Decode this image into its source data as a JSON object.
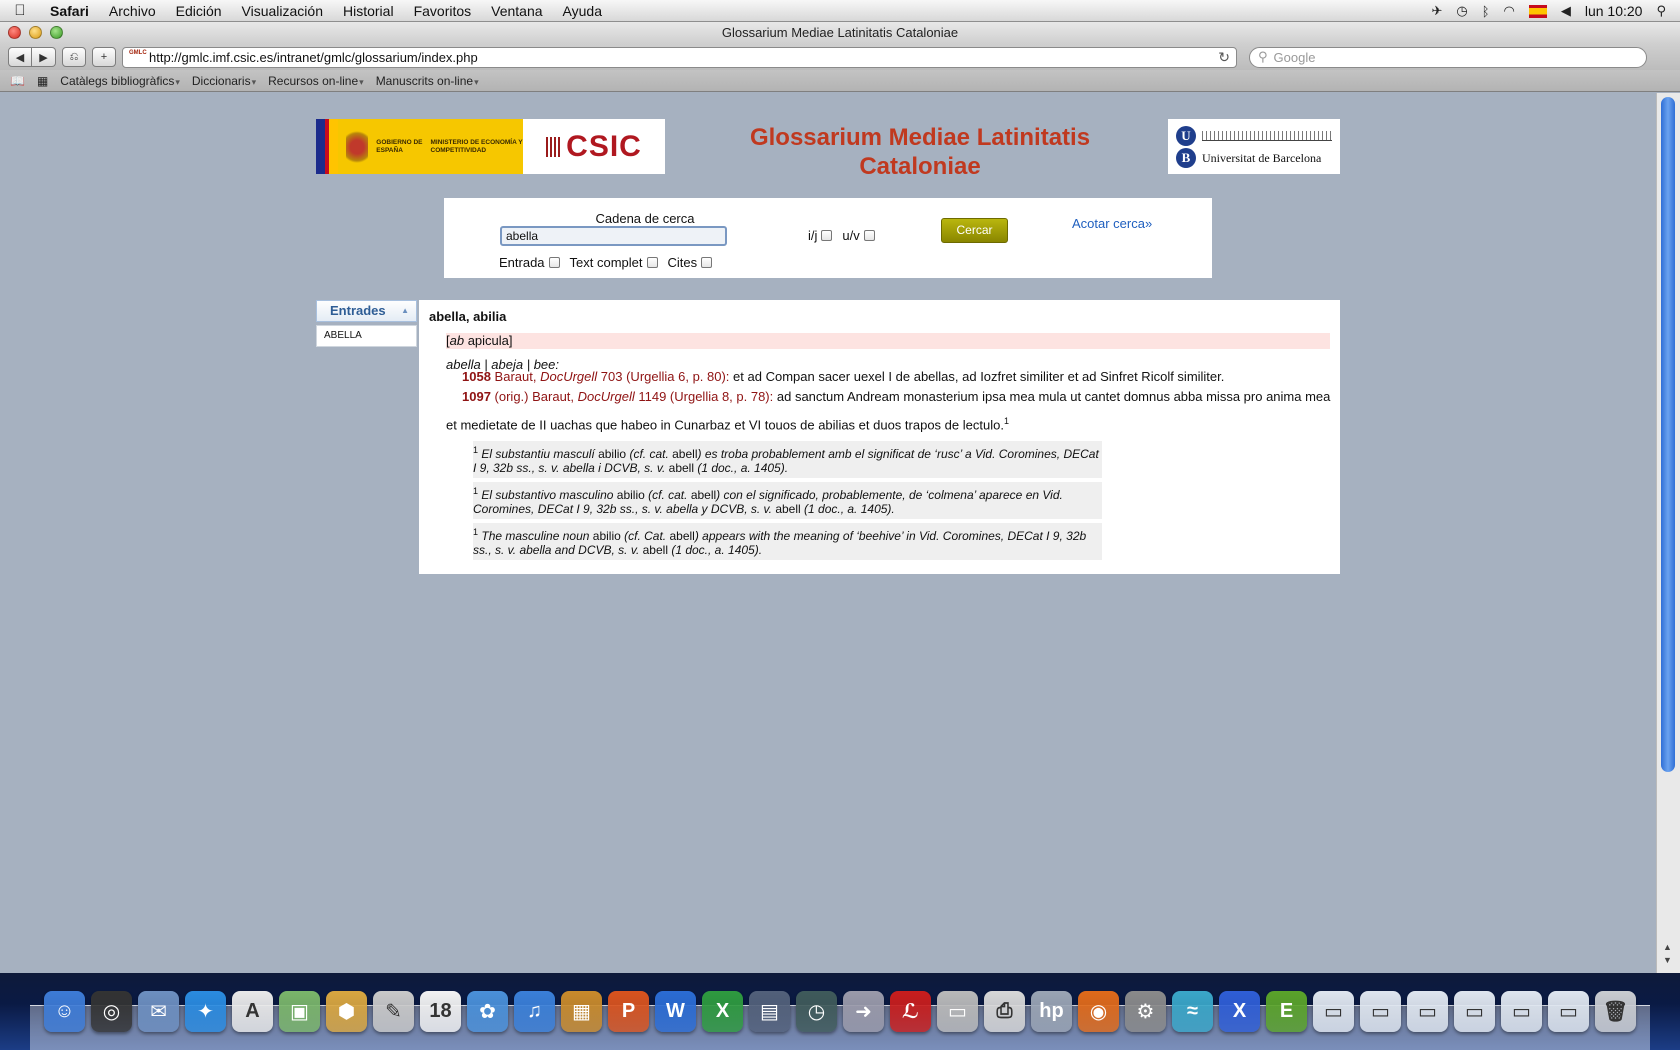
{
  "menubar": {
    "app": "Safari",
    "items": [
      "Archivo",
      "Edición",
      "Visualización",
      "Historial",
      "Favoritos",
      "Ventana",
      "Ayuda"
    ],
    "clock": "lun 10:20",
    "flag_label": "ISO"
  },
  "window": {
    "title": "Glossarium Mediae Latinitatis Cataloniae"
  },
  "toolbar": {
    "url": "http://gmlc.imf.csic.es/intranet/gmlc/glossarium/index.php",
    "search_placeholder": "Google",
    "favicon_text": "GMLC"
  },
  "bookmarks": {
    "items": [
      "Catàlegs bibliogràfics",
      "Diccionaris",
      "Recursos on-line",
      "Manuscrits on-line"
    ]
  },
  "header": {
    "gov_text": "GOBIERNO DE ESPAÑA",
    "ministry_text": "MINISTERIO DE ECONOMÍA Y COMPETITIVIDAD",
    "csic": "CSIC",
    "title": "Glossarium Mediae Latinitatis Cataloniae",
    "university": "Universitat de Barcelona"
  },
  "search": {
    "label": "Cadena de cerca",
    "value": "abella",
    "check_entrada": "Entrada",
    "check_text": "Text complet",
    "check_cites": "Cites",
    "check_ij": "i/j",
    "check_uv": "u/v",
    "button": "Cercar",
    "refine_link": "Acotar cerca»"
  },
  "entries": {
    "header": "Entrades",
    "items": [
      "ABELLA"
    ]
  },
  "article": {
    "headword": "abella, abilia",
    "etymology_pre": "[",
    "etymology_it": "ab",
    "etymology_post": " apicula]",
    "sense": "abella | abeja | bee:",
    "citations": [
      {
        "year": "1058",
        "author": "Baraut,",
        "work": "DocUrgell",
        "ref": "703 (Urgellia 6, p. 80):",
        "text": "et ad Compan sacer uexel I de abellas, ad Iozfret similiter et ad Sinfret Ricolf similiter."
      },
      {
        "year": "1097",
        "author": "(orig.) Baraut,",
        "work": "DocUrgell",
        "ref": "1149 (Urgellia 8, p. 78):",
        "text": "ad sanctum Andream monasterium ipsa mea mula ut cantet domnus abba missa pro anima mea et medietate de II uachas que habeo in Cunarbaz et VI touos de abilias et duos trapos de lectulo.",
        "footnote_mark": "1"
      }
    ],
    "notes": [
      {
        "mark": "1",
        "a": "El substantiu masculí ",
        "word1": "abilio",
        "b": " (cf. cat. ",
        "word2": "abell",
        "c": ") es troba probablement amb el significat de ‘rusc’ a Vid. Coromines, DECat I 9, 32b ss., s. v. abella i DCVB, s. v. ",
        "word3": "abell",
        "d": " (1 doc., a. 1405)."
      },
      {
        "mark": "1",
        "a": "El substantivo masculino ",
        "word1": "abilio",
        "b": " (cf. cat. ",
        "word2": "abell",
        "c": ") con el significado, probablemente, de ‘colmena’ aparece en Vid. Coromines, DECat I 9, 32b ss., s. v. abella y DCVB, s. v. ",
        "word3": "abell",
        "d": " (1 doc., a. 1405)."
      },
      {
        "mark": "1",
        "a": "The masculine noun ",
        "word1": "abilio",
        "b": " (cf. Cat. ",
        "word2": "abell",
        "c": ") appears with the meaning of ‘beehive’ in Vid. Coromines, DECat I 9, 32b ss., s. v. abella and DCVB, s. v. ",
        "word3": "abell",
        "d": " (1 doc., a. 1405)."
      }
    ]
  },
  "dock": {
    "icons": [
      {
        "name": "finder-icon",
        "glyph": "☺",
        "color": "#3d7bd6"
      },
      {
        "name": "dashboard-icon",
        "glyph": "◎",
        "color": "#333333"
      },
      {
        "name": "mail-icon",
        "glyph": "✉",
        "color": "#6d8fc0"
      },
      {
        "name": "safari-icon",
        "glyph": "✦",
        "color": "#2a8be0"
      },
      {
        "name": "textedit-icon",
        "glyph": "A",
        "color": "#e9e9e9"
      },
      {
        "name": "preview-icon",
        "glyph": "▣",
        "color": "#7ab56a"
      },
      {
        "name": "installer-icon",
        "glyph": "⬢",
        "color": "#d9a640"
      },
      {
        "name": "script-editor-icon",
        "glyph": "✎",
        "color": "#c9c9c9"
      },
      {
        "name": "ical-icon",
        "glyph": "18",
        "color": "#f2f2f2"
      },
      {
        "name": "iphoto-icon",
        "glyph": "✿",
        "color": "#4a90d9"
      },
      {
        "name": "itunes-icon",
        "glyph": "♫",
        "color": "#3a7fd8"
      },
      {
        "name": "image-capture-icon",
        "glyph": "▦",
        "color": "#c98a2b"
      },
      {
        "name": "powerpoint-icon",
        "glyph": "P",
        "color": "#d9531e"
      },
      {
        "name": "word-icon",
        "glyph": "W",
        "color": "#2b6cd4"
      },
      {
        "name": "excel-icon",
        "glyph": "X",
        "color": "#2e9a3f"
      },
      {
        "name": "spaces-icon",
        "glyph": "▤",
        "color": "#52607a"
      },
      {
        "name": "time-machine-icon",
        "glyph": "◷",
        "color": "#3f5a5a"
      },
      {
        "name": "migration-icon",
        "glyph": "➜",
        "color": "#9a9aaa"
      },
      {
        "name": "acrobat-icon",
        "glyph": "ℒ",
        "color": "#c81d1d"
      },
      {
        "name": "scanner-icon",
        "glyph": "▭",
        "color": "#b9b9b9"
      },
      {
        "name": "printer-icon",
        "glyph": "⎙",
        "color": "#d7d7d7"
      },
      {
        "name": "hp-icon",
        "glyph": "hp",
        "color": "#9aa4b4"
      },
      {
        "name": "firefox-icon",
        "glyph": "◉",
        "color": "#e06a1a"
      },
      {
        "name": "system-preferences-icon",
        "glyph": "⚙",
        "color": "#8a8a8a"
      },
      {
        "name": "network-icon",
        "glyph": "≈",
        "color": "#3aa6c8"
      },
      {
        "name": "x11-icon",
        "glyph": "X",
        "color": "#2f5ed6"
      },
      {
        "name": "evernote-icon",
        "glyph": "E",
        "color": "#5aa32a"
      },
      {
        "name": "window-thumbnail-1-icon",
        "glyph": "▭",
        "color": "#dfe6ef"
      },
      {
        "name": "window-thumbnail-2-icon",
        "glyph": "▭",
        "color": "#dfe6ef"
      },
      {
        "name": "window-thumbnail-3-icon",
        "glyph": "▭",
        "color": "#dfe6ef"
      },
      {
        "name": "window-thumbnail-4-icon",
        "glyph": "▭",
        "color": "#dfe6ef"
      },
      {
        "name": "window-thumbnail-5-icon",
        "glyph": "▭",
        "color": "#dfe6ef"
      },
      {
        "name": "window-thumbnail-6-icon",
        "glyph": "▭",
        "color": "#dfe6ef"
      },
      {
        "name": "trash-icon",
        "glyph": "🗑",
        "color": "#c9ccd1"
      }
    ]
  },
  "colors": {
    "title_red": "#c0391f",
    "citation_red": "#8f1313",
    "button_olive": "#a09d00",
    "link_blue": "#1f5fbf",
    "page_bg": "#a6b1c0"
  }
}
